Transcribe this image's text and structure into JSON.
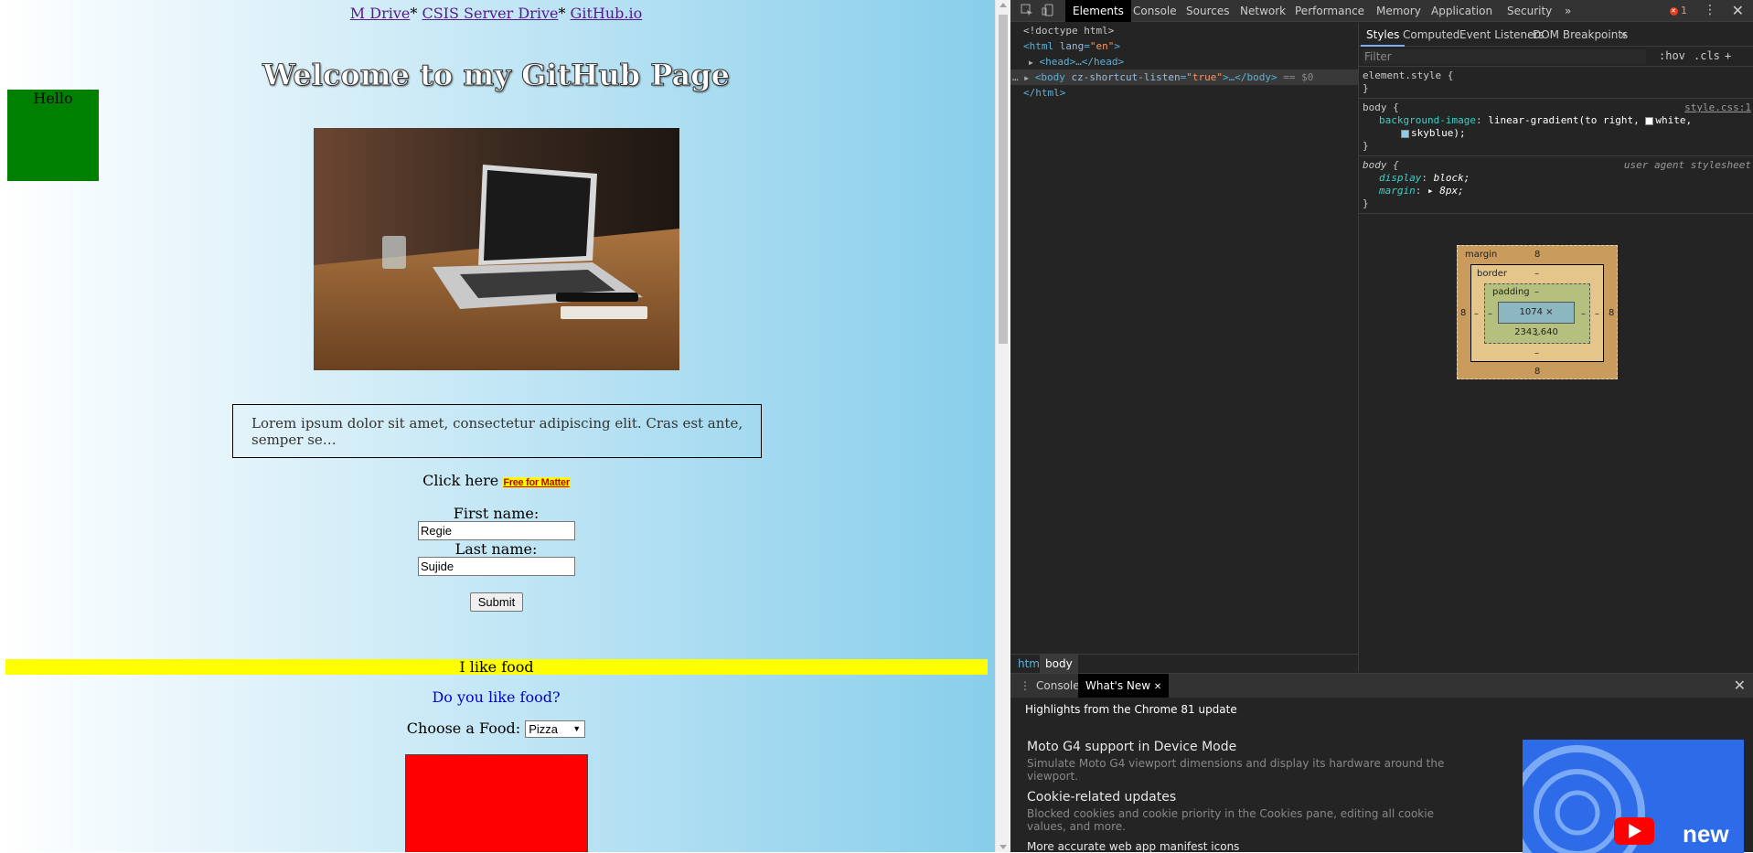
{
  "page": {
    "nav": [
      {
        "label": "M Drive",
        "sep": "*"
      },
      {
        "label": "CSIS Server Drive",
        "sep": "*"
      },
      {
        "label": "GitHub.io",
        "sep": ""
      }
    ],
    "hello": "Hello",
    "heading": "Welcome to my GitHub Page",
    "lorem": "Lorem ipsum dolor sit amet, consectetur adipiscing elit. Cras est ante, semper se…",
    "click_here": "Click here",
    "matter_link": "Free for Matter",
    "first_name_label": "First name:",
    "first_name_value": "Regie",
    "last_name_label": "Last name:",
    "last_name_value": "Sujide",
    "submit": "Submit",
    "food_banner": "I like food",
    "food_question": "Do you like food?",
    "choose_food": "Choose a Food:",
    "food_selected": "Pizza",
    "colors": {
      "green_box": "#008000",
      "yellow_banner": "#ffff00",
      "red_box": "#ff0000",
      "gradient_end": "#87ceeb"
    }
  },
  "devtools": {
    "tabs": [
      "Elements",
      "Console",
      "Sources",
      "Network",
      "Performance",
      "Memory",
      "Application",
      "Security"
    ],
    "active_tab": "Elements",
    "more_tabs": "»",
    "error_count": "1",
    "dom": {
      "doctype": "<!doctype html>",
      "html_open_tag": "html",
      "html_lang_attr": "lang",
      "html_lang_val": "\"en\"",
      "head": "<head>…</head>",
      "body_tag": "body",
      "body_attr": "cz-shortcut-listen",
      "body_attr_val": "\"true\"",
      "body_rest": "…</body>",
      "body_eq": "== $0",
      "html_close": "</html>"
    },
    "breadcrumbs": [
      "html",
      "body"
    ],
    "styles_tabs": [
      "Styles",
      "Computed",
      "Event Listeners",
      "DOM Breakpoints"
    ],
    "filter_placeholder": "Filter",
    "filter_hov": ":hov",
    "filter_cls": ".cls",
    "filter_plus": "+",
    "rules": {
      "element_style": "element.style {",
      "close": "}",
      "body_sel": "body {",
      "body_src": "style.css:1",
      "bg_prop": "background-image",
      "bg_val_1": "linear-gradient(to right,",
      "bg_white": "white,",
      "bg_sky": "skyblue);",
      "ua_sel": "body {",
      "ua_src": "user agent stylesheet",
      "display_prop": "display",
      "display_val": "block;",
      "margin_prop": "margin",
      "margin_val": "▸ 8px;"
    },
    "box_model": {
      "margin_label": "margin",
      "border_label": "border",
      "padding_label": "padding",
      "margin_top": "8",
      "margin_bottom": "8",
      "margin_left": "8",
      "margin_right": "8",
      "border_val": "–",
      "padding_val": "–",
      "content": "1074 × 2343.640"
    },
    "drawer": {
      "tabs": [
        "Console",
        "What's New"
      ],
      "active": "What's New",
      "highlights": "Highlights from the Chrome 81 update",
      "items": [
        {
          "title": "Moto G4 support in Device Mode",
          "desc": "Simulate Moto G4 viewport dimensions and display its hardware around the viewport."
        },
        {
          "title": "Cookie-related updates",
          "desc": "Blocked cookies and cookie priority in the Cookies pane, editing all cookie values, and more."
        },
        {
          "title": "More accurate web app manifest icons",
          "desc": ""
        }
      ],
      "banner_text": "new"
    }
  }
}
